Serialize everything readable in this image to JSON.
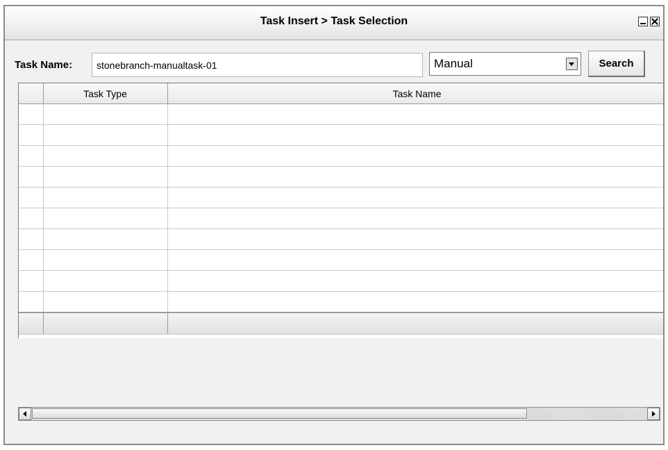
{
  "window": {
    "title": "Task Insert > Task Selection"
  },
  "search": {
    "label": "Task Name:",
    "task_name_value": "stonebranch-manualtask-01",
    "task_type_selected": "Manual",
    "search_button_label": "Search"
  },
  "grid": {
    "columns": [
      "",
      "Task Type",
      "Task Name"
    ],
    "rows": [
      [
        "",
        "",
        ""
      ],
      [
        "",
        "",
        ""
      ],
      [
        "",
        "",
        ""
      ],
      [
        "",
        "",
        ""
      ],
      [
        "",
        "",
        ""
      ],
      [
        "",
        "",
        ""
      ],
      [
        "",
        "",
        ""
      ],
      [
        "",
        "",
        ""
      ],
      [
        "",
        "",
        ""
      ],
      [
        "",
        "",
        ""
      ]
    ]
  },
  "icons": {
    "minimize": "minimize-icon",
    "close": "close-icon",
    "dropdown": "chevron-down-icon",
    "scroll_left": "arrow-left-icon",
    "scroll_right": "arrow-right-icon"
  }
}
